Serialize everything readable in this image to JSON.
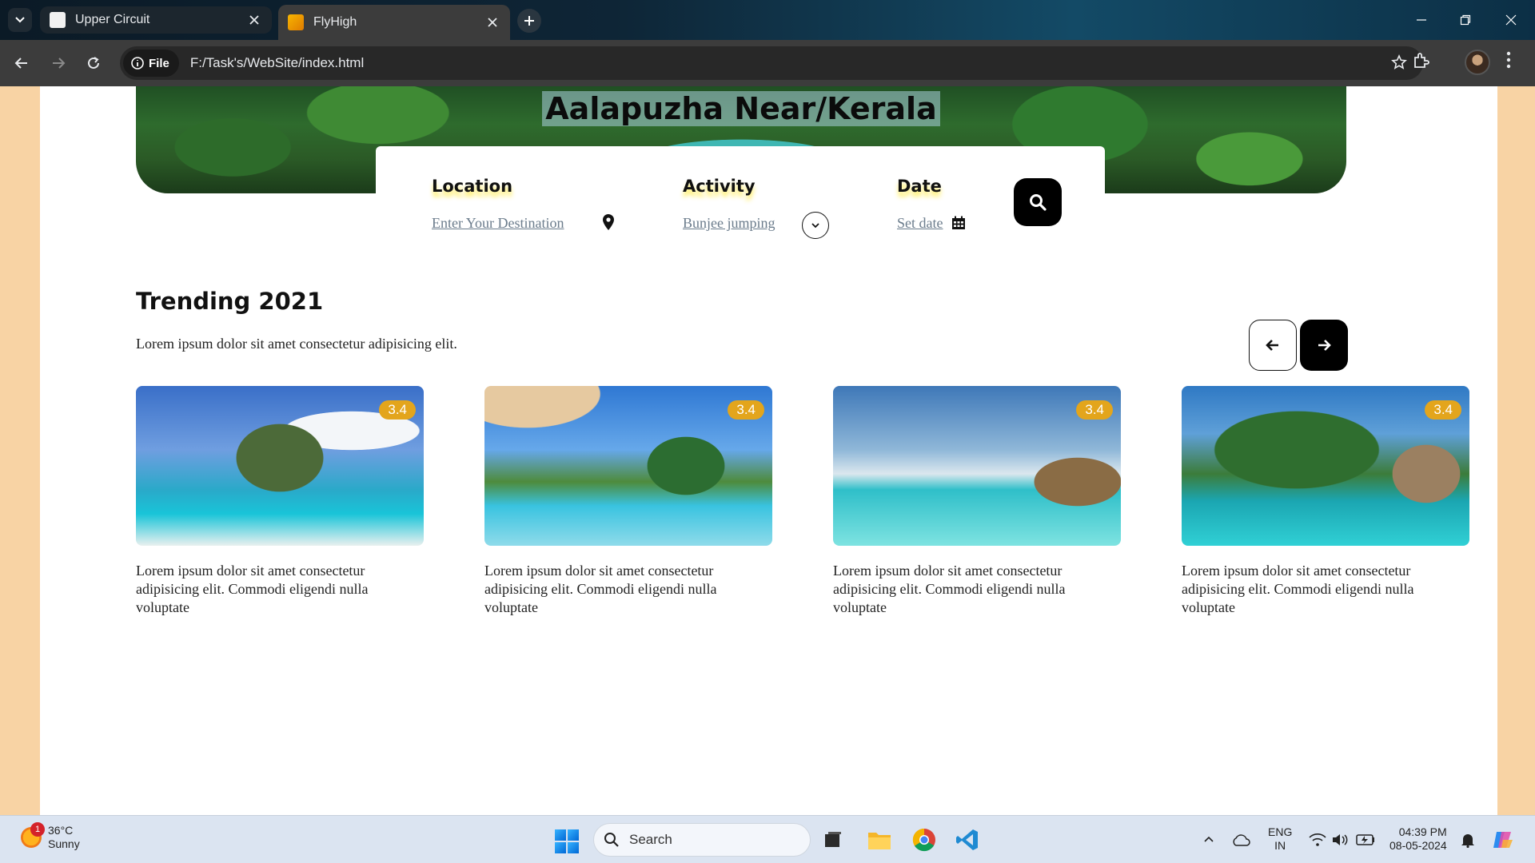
{
  "browser": {
    "tabs": [
      {
        "title": "Upper Circuit",
        "active": false
      },
      {
        "title": "FlyHigh",
        "active": true
      }
    ],
    "site_chip": "File",
    "url": "F:/Task's/WebSite/index.html"
  },
  "hero": {
    "title": "Aalapuzha Near/Kerala"
  },
  "search": {
    "location_label": "Location",
    "location_value": "Enter Your Destination",
    "activity_label": "Activity",
    "activity_value": "Bunjee jumping",
    "date_label": "Date",
    "date_value": "Set date"
  },
  "trending": {
    "title": "Trending 2021",
    "subtitle": "Lorem ipsum dolor sit amet consectetur adipisicing elit.",
    "cards": [
      {
        "rating": "3.4",
        "text": "Lorem ipsum dolor sit amet consectetur adipisicing elit. Commodi eligendi nulla voluptate"
      },
      {
        "rating": "3.4",
        "text": "Lorem ipsum dolor sit amet consectetur adipisicing elit. Commodi eligendi nulla voluptate"
      },
      {
        "rating": "3.4",
        "text": "Lorem ipsum dolor sit amet consectetur adipisicing elit. Commodi eligendi nulla voluptate"
      },
      {
        "rating": "3.4",
        "text": "Lorem ipsum dolor sit amet consectetur adipisicing elit. Commodi eligendi nulla voluptate"
      }
    ]
  },
  "taskbar": {
    "weather_temp": "36°C",
    "weather_desc": "Sunny",
    "weather_badge": "1",
    "search_label": "Search",
    "lang_line1": "ENG",
    "lang_line2": "IN",
    "time": "04:39 PM",
    "date": "08-05-2024"
  },
  "colors": {
    "page_background": "#f8d3a4",
    "rating_badge": "#e3a51c",
    "label_highlight": "#ffec50"
  }
}
